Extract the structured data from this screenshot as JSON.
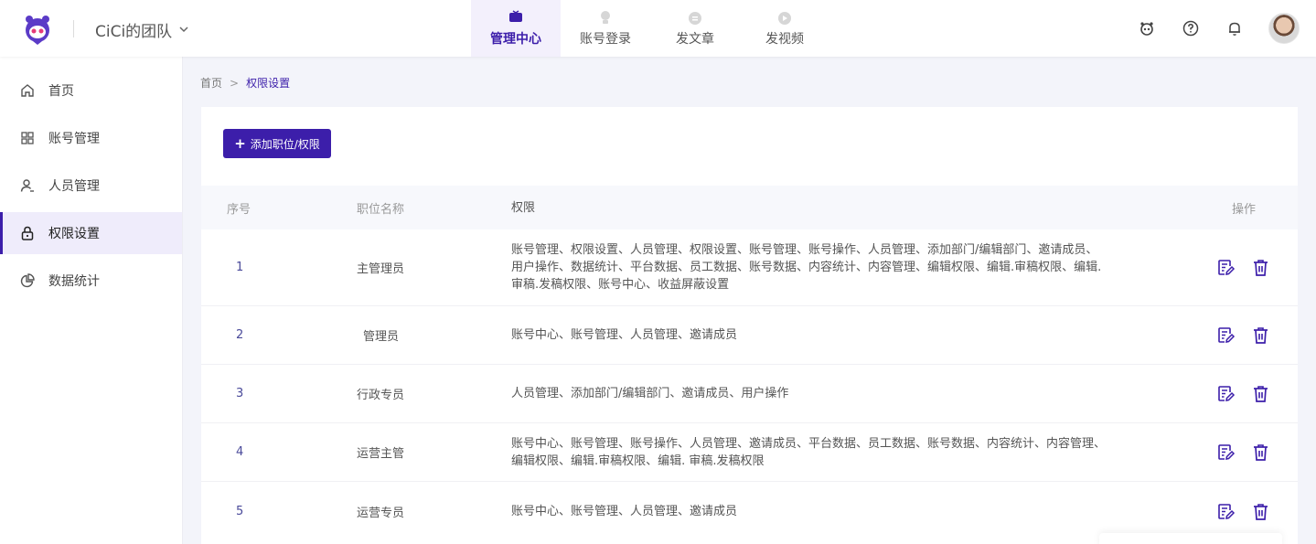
{
  "app": {
    "team_name": "CiCi的团队",
    "accent_color": "#3c1eaa"
  },
  "top_nav": [
    {
      "label": "管理中心",
      "icon": "monitor-icon",
      "active": true
    },
    {
      "label": "账号登录",
      "icon": "account-login-icon",
      "active": false
    },
    {
      "label": "发文章",
      "icon": "article-icon",
      "active": false
    },
    {
      "label": "发视频",
      "icon": "video-icon",
      "active": false
    }
  ],
  "header_icons": [
    "robot-icon",
    "help-icon",
    "bell-icon",
    "user-avatar"
  ],
  "sidebar": {
    "items": [
      {
        "label": "首页",
        "icon": "home-icon",
        "active": false
      },
      {
        "label": "账号管理",
        "icon": "grid-icon",
        "active": false
      },
      {
        "label": "人员管理",
        "icon": "user-icon",
        "active": false
      },
      {
        "label": "权限设置",
        "icon": "lock-icon",
        "active": true
      },
      {
        "label": "数据统计",
        "icon": "pie-chart-icon",
        "active": false
      }
    ]
  },
  "breadcrumb": {
    "home": "首页",
    "separator": ">",
    "current": "权限设置"
  },
  "toolbar": {
    "add_label": "添加职位/权限"
  },
  "table": {
    "headers": {
      "index": "序号",
      "name": "职位名称",
      "permissions": "权限",
      "ops": "操作"
    },
    "rows": [
      {
        "index": "1",
        "name": "主管理员",
        "permissions": [
          "账号管理、权限设置、人员管理、权限设置、账号管理、账号操作、人员管理、添加部门/编辑部门、邀请成员、",
          "用户操作、数据统计、平台数据、员工数据、账号数据、内容统计、内容管理、编辑权限、编辑.审稿权限、编辑.",
          "审稿.发稿权限、账号中心、收益屏蔽设置"
        ]
      },
      {
        "index": "2",
        "name": "管理员",
        "permissions": [
          "账号中心、账号管理、人员管理、邀请成员"
        ]
      },
      {
        "index": "3",
        "name": "行政专员",
        "permissions": [
          "人员管理、添加部门/编辑部门、邀请成员、用户操作"
        ]
      },
      {
        "index": "4",
        "name": "运营主管",
        "permissions": [
          "账号中心、账号管理、账号操作、人员管理、邀请成员、平台数据、员工数据、账号数据、内容统计、内容管理、",
          "编辑权限、编辑.审稿权限、编辑. 审稿.发稿权限"
        ]
      },
      {
        "index": "5",
        "name": "运营专员",
        "permissions": [
          "账号中心、账号管理、人员管理、邀请成员"
        ]
      }
    ]
  }
}
